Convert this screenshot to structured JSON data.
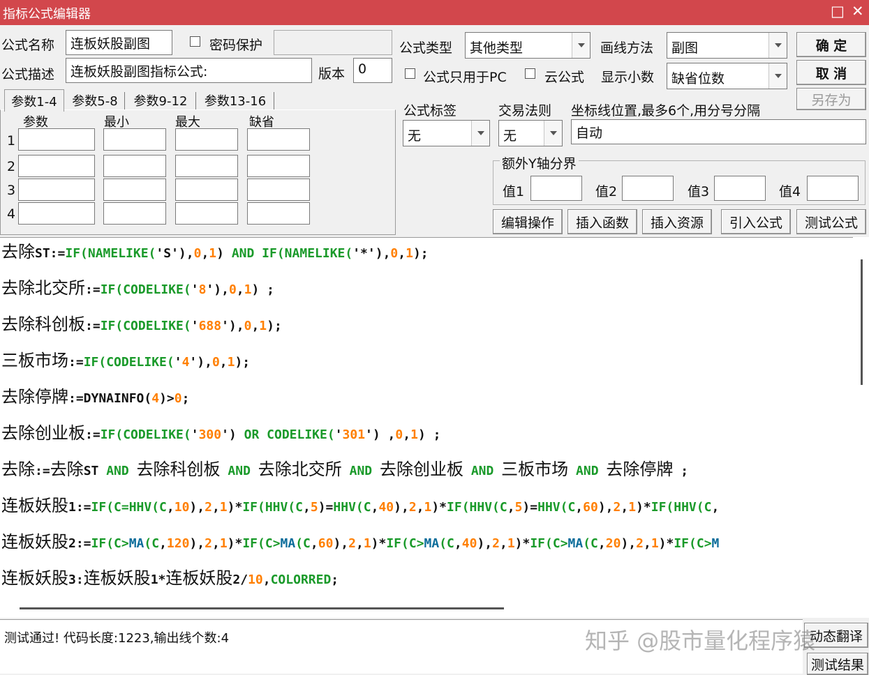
{
  "window": {
    "title": "指标公式编辑器",
    "restore_glyph": "□",
    "close_glyph": "✕"
  },
  "form": {
    "name_label": "公式名称",
    "name_value": "连板妖股副图",
    "password_label": "密码保护",
    "password_value": "",
    "desc_label": "公式描述",
    "desc_value": "连板妖股副图指标公式:",
    "version_label": "版本",
    "version_value": "0",
    "type_label": "公式类型",
    "type_value": "其他类型",
    "draw_label": "画线方法",
    "draw_value": "副图",
    "pc_only_label": "公式只用于PC",
    "cloud_label": "云公式",
    "decimals_label": "显示小数",
    "decimals_value": "缺省位数",
    "tag_label": "公式标签",
    "tag_value": "无",
    "trade_label": "交易法则",
    "trade_value": "无",
    "coord_label": "坐标线位置,最多6个,用分号分隔",
    "coord_value": "自动",
    "y_group_label": "额外Y轴分界",
    "y_values": [
      "值1",
      "值2",
      "值3",
      "值4"
    ]
  },
  "buttons": {
    "ok": "确  定",
    "cancel": "取  消",
    "save_as": "另存为",
    "edit_ops": "编辑操作",
    "insert_func": "插入函数",
    "insert_res": "插入资源",
    "import": "引入公式",
    "test": "测试公式",
    "compile": "动态翻译",
    "test_result": "测试结果"
  },
  "param_tabs": [
    "参数1-4",
    "参数5-8",
    "参数9-12",
    "参数13-16"
  ],
  "param_headers": [
    "参数",
    "最小",
    "最大",
    "缺省"
  ],
  "param_rows": [
    "1",
    "2",
    "3",
    "4"
  ],
  "status": {
    "text": "测试通过! 代码长度:1223,输出线个数:4"
  },
  "watermark": "知乎 @股市量化程序猿"
}
